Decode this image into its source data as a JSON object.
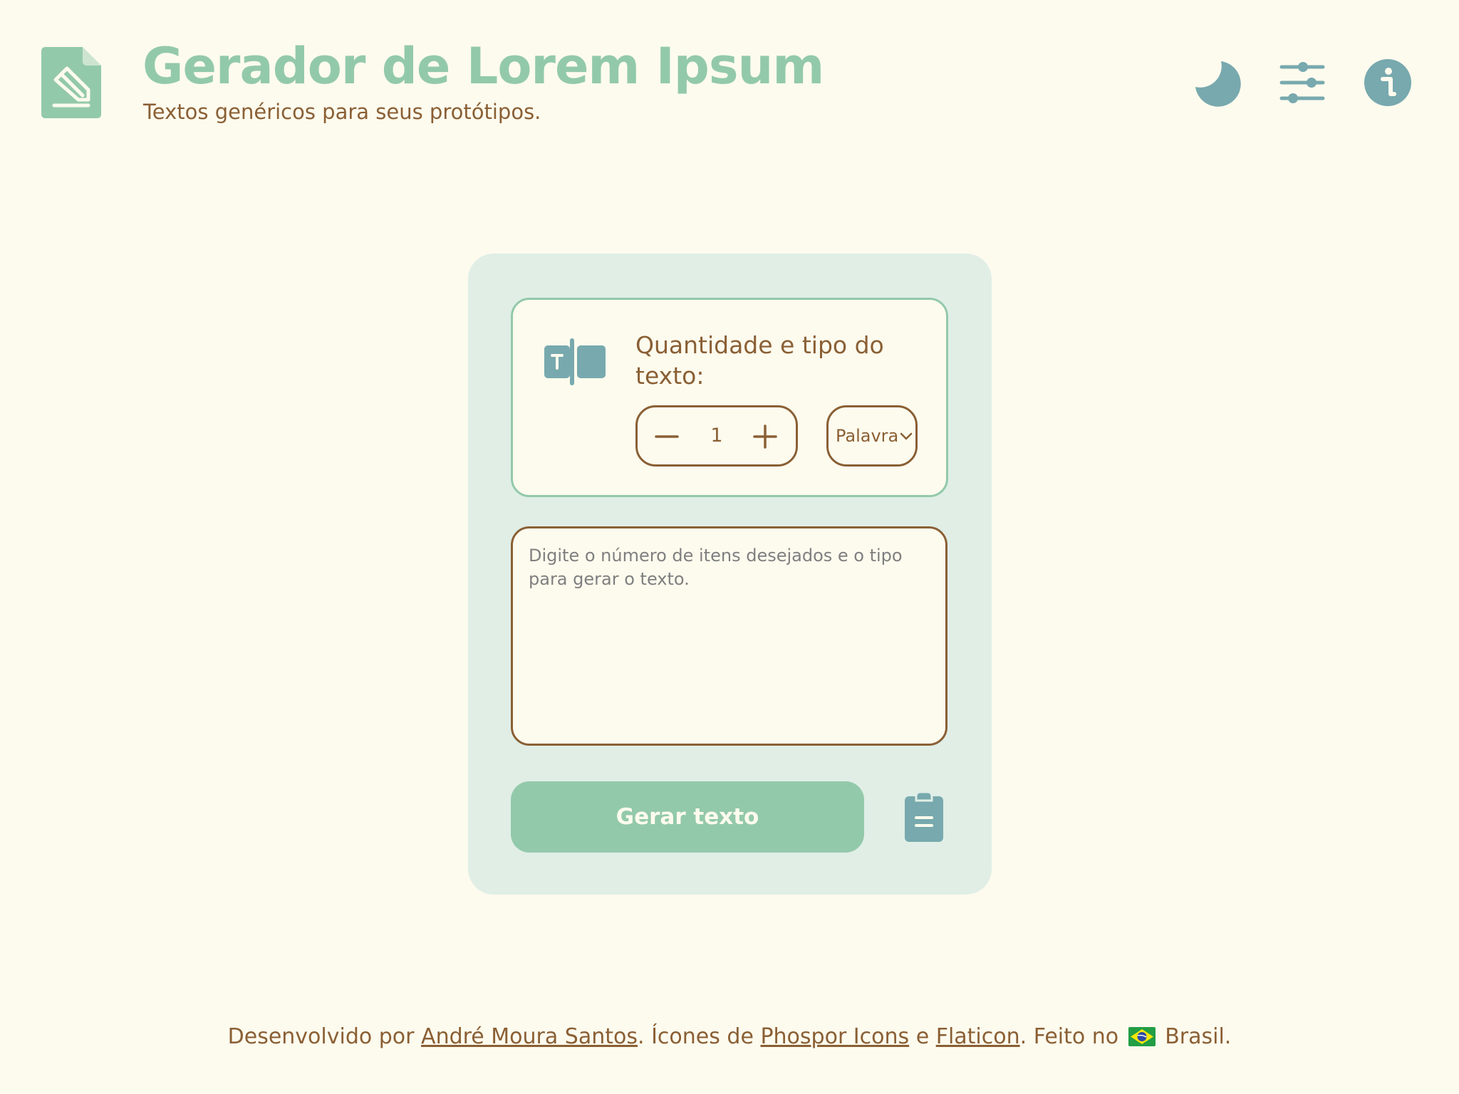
{
  "header": {
    "title": "Gerador de Lorem Ipsum",
    "subtitle": "Textos genéricos para seus protótipos.",
    "icons": [
      "document-pencil-icon",
      "moon-icon",
      "sliders-icon",
      "info-icon"
    ]
  },
  "settings": {
    "label": "Quantidade e tipo do texto:",
    "quantity": "1",
    "type_selected": "Palavra",
    "icon": "text-columns-icon"
  },
  "output": {
    "placeholder": "Digite o número de itens desejados e o tipo para gerar o texto."
  },
  "actions": {
    "generate_label": "Gerar texto",
    "copy_icon": "clipboard-icon"
  },
  "footer": {
    "prefix": "Desenvolvido por ",
    "author": "André Moura Santos",
    "mid1": ". Ícones de ",
    "phosphor": "Phospor Icons",
    "mid2": " e ",
    "flaticon": "Flaticon",
    "mid3": ". Feito no ",
    "suffix": " Brasil."
  },
  "colors": {
    "background": "#fdfbee",
    "accent_green": "#93c9ab",
    "accent_teal": "#77a9ae",
    "brown": "#8a5f34",
    "card": "#e0eee6"
  }
}
